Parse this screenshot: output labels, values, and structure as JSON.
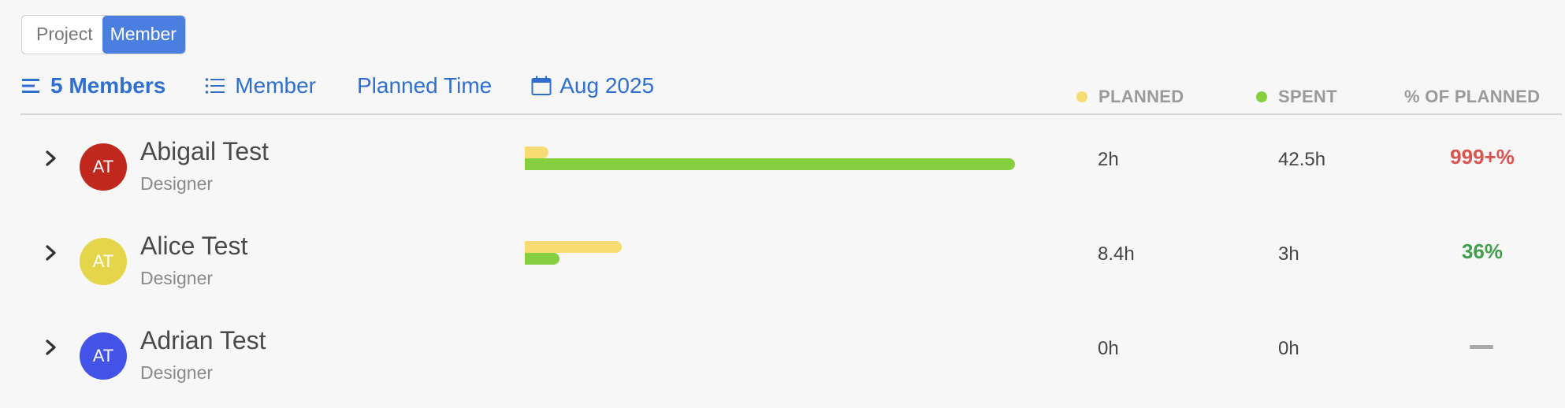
{
  "view_toggle": {
    "project": "Project",
    "member": "Member"
  },
  "toolbar": {
    "members_count": "5 Members",
    "group_by": "Member",
    "metric": "Planned Time",
    "date": "Aug 2025"
  },
  "legend": {
    "planned": "PLANNED",
    "spent": "SPENT",
    "percent": "% OF PLANNED"
  },
  "colors": {
    "accent": "#2f6fd1",
    "planned": "#f7dc74",
    "spent": "#86d03f",
    "over": "#d9534f",
    "under": "#3f9f4a"
  },
  "members": [
    {
      "initials": "AT",
      "name": "Abigail Test",
      "role": "Designer",
      "avatar_color": "#c0271d",
      "planned_hours": 2,
      "spent_hours": 42.5,
      "planned": "2h",
      "spent": "42.5h",
      "percent": "999+%",
      "percent_color": "#d9534f"
    },
    {
      "initials": "AT",
      "name": "Alice Test",
      "role": "Designer",
      "avatar_color": "#e5d54a",
      "planned_hours": 8.4,
      "spent_hours": 3,
      "planned": "8.4h",
      "spent": "3h",
      "percent": "36%",
      "percent_color": "#3f9f4a"
    },
    {
      "initials": "AT",
      "name": "Adrian Test",
      "role": "Designer",
      "avatar_color": "#4353e8",
      "planned_hours": 0,
      "spent_hours": 0,
      "planned": "0h",
      "spent": "0h",
      "percent": "",
      "percent_color": "#a8a8a8"
    }
  ]
}
